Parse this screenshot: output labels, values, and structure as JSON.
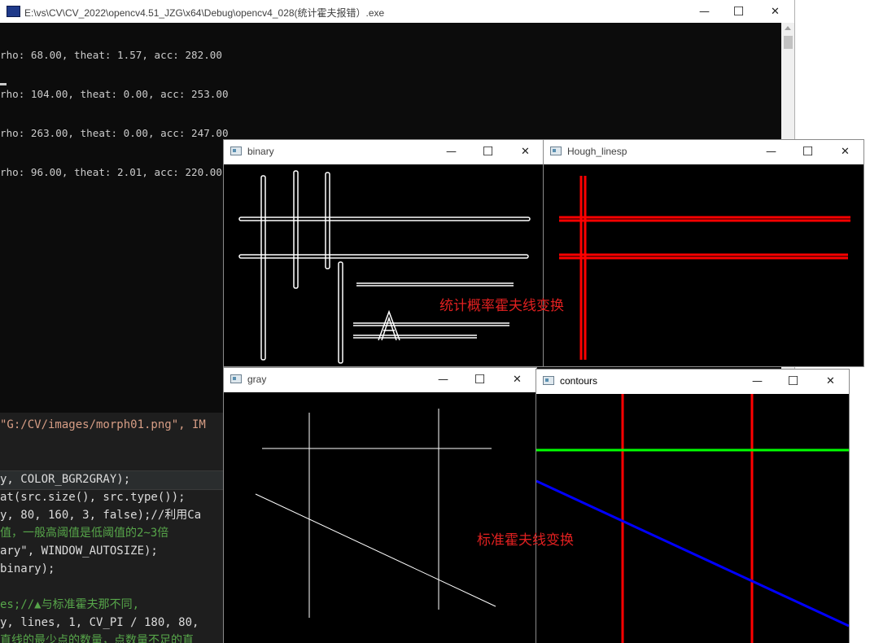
{
  "console": {
    "title": "E:\\vs\\CV\\CV_2022\\opencv4.51_JZG\\x64\\Debug\\opencv4_028(统计霍夫报错）.exe",
    "lines": [
      "rho: 68.00, theat: 1.57, acc: 282.00",
      "rho: 104.00, theat: 0.00, acc: 253.00",
      "rho: 263.00, theat: 0.00, acc: 247.00",
      "rho: 96.00, theat: 2.01, acc: 220.00"
    ],
    "cursor": "_"
  },
  "window_buttons": {
    "minimize": "—",
    "maximize": "☐",
    "close": "✕"
  },
  "code_editor": {
    "lines": [
      {
        "text": "\"G:/CV/images/morph01.png\", IM",
        "color": "#d69d85"
      },
      {
        "text": "y, COLOR_BGR2GRAY);",
        "color": "#dcdcdc"
      },
      {
        "text": "at(src.size(), src.type());",
        "color": "#dcdcdc"
      },
      {
        "text": "y, 80, 160, 3, false);//利用Ca",
        "color": "#dcdcdc"
      },
      {
        "text": "值，一般高阈值是低阈值的2~3倍",
        "color": "#57a64a"
      },
      {
        "text": "ary\", WINDOW_AUTOSIZE);",
        "color": "#dcdcdc"
      },
      {
        "text": "binary);",
        "color": "#dcdcdc"
      },
      {
        "text": "es;//▲与标准霍夫那不同,",
        "color": "#57a64a"
      },
      {
        "text": "y, lines, 1, CV_PI / 180, 80,",
        "color": "#dcdcdc"
      },
      {
        "text": "直线的最少点的数量，点数量不足的直",
        "color": "#57a64a"
      }
    ]
  },
  "windows": {
    "binary": {
      "title": "binary"
    },
    "hough_linesp": {
      "title": "Hough_linesp"
    },
    "gray": {
      "title": "gray"
    },
    "contours": {
      "title": "contours"
    }
  },
  "overlays": {
    "probabilistic_label": "统计概率霍夫线变换",
    "standard_label": "标准霍夫线变换"
  },
  "colors": {
    "console_bg": "#0c0c0c",
    "hough_red": "#ff0000",
    "hough_green": "#00ff00",
    "hough_blue": "#0000ff",
    "label_red": "#e02020"
  }
}
